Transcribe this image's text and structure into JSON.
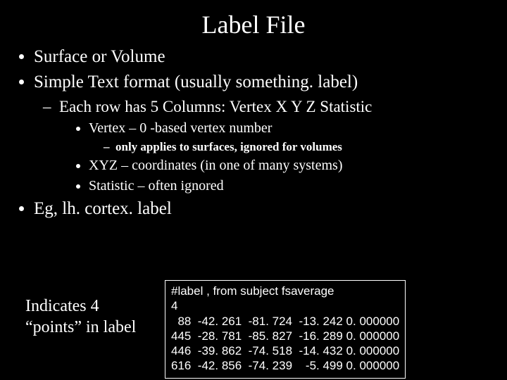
{
  "title": "Label File",
  "bullets": {
    "b1": "Surface or Volume",
    "b2": "Simple Text format (usually something. label)",
    "b2_1": "Each row has 5 Columns: Vertex  X Y Z Statistic",
    "b2_1_a": "Vertex – 0 -based vertex number",
    "b2_1_a_i": "only applies to surfaces, ignored for volumes",
    "b2_1_b": "XYZ – coordinates (in one of many systems)",
    "b2_1_c": "Statistic – often ignored",
    "b3": "Eg, lh. cortex. label"
  },
  "caption": "Indicates 4 “points” in label",
  "code": {
    "l1": "#label , from subject fsaverage",
    "l2": "4",
    "l3": "  88  -42. 261  -81. 724  -13. 242 0. 000000",
    "l4": "445  -28. 781  -85. 827  -16. 289 0. 000000",
    "l5": "446  -39. 862  -74. 518  -14. 432 0. 000000",
    "l6": "616  -42. 856  -74. 239    -5. 499 0. 000000"
  }
}
